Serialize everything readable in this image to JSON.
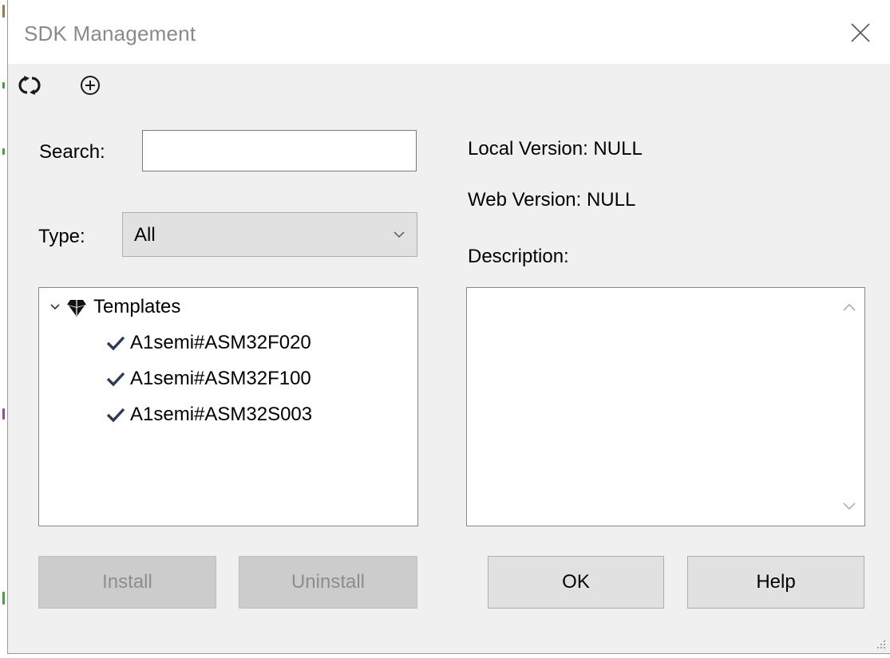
{
  "window": {
    "title": "SDK Management"
  },
  "toolbar": {
    "refresh_icon": "refresh-icon",
    "add_icon": "add-circle-icon"
  },
  "search": {
    "label": "Search:",
    "value": "",
    "placeholder": ""
  },
  "type": {
    "label": "Type:",
    "selected": "All"
  },
  "tree": {
    "root": {
      "label": "Templates",
      "expanded": true,
      "icon": "sdk-diamond-icon"
    },
    "items": [
      {
        "label": "A1semi#ASM32F020",
        "installed": true
      },
      {
        "label": "A1semi#ASM32F100",
        "installed": true
      },
      {
        "label": "A1semi#ASM32S003",
        "installed": true
      }
    ]
  },
  "info": {
    "local_version": "Local Version: NULL",
    "web_version": "Web Version: NULL",
    "description_label": "Description:",
    "description_text": ""
  },
  "buttons": {
    "install": "Install",
    "uninstall": "Uninstall",
    "ok": "OK",
    "help": "Help"
  },
  "colors": {
    "title_text": "#8a8a8a",
    "dialog_bg": "#f0f0f0",
    "disabled_button": "#cccccc",
    "enabled_button": "#e1e1e1",
    "check": "#2b3a55"
  }
}
